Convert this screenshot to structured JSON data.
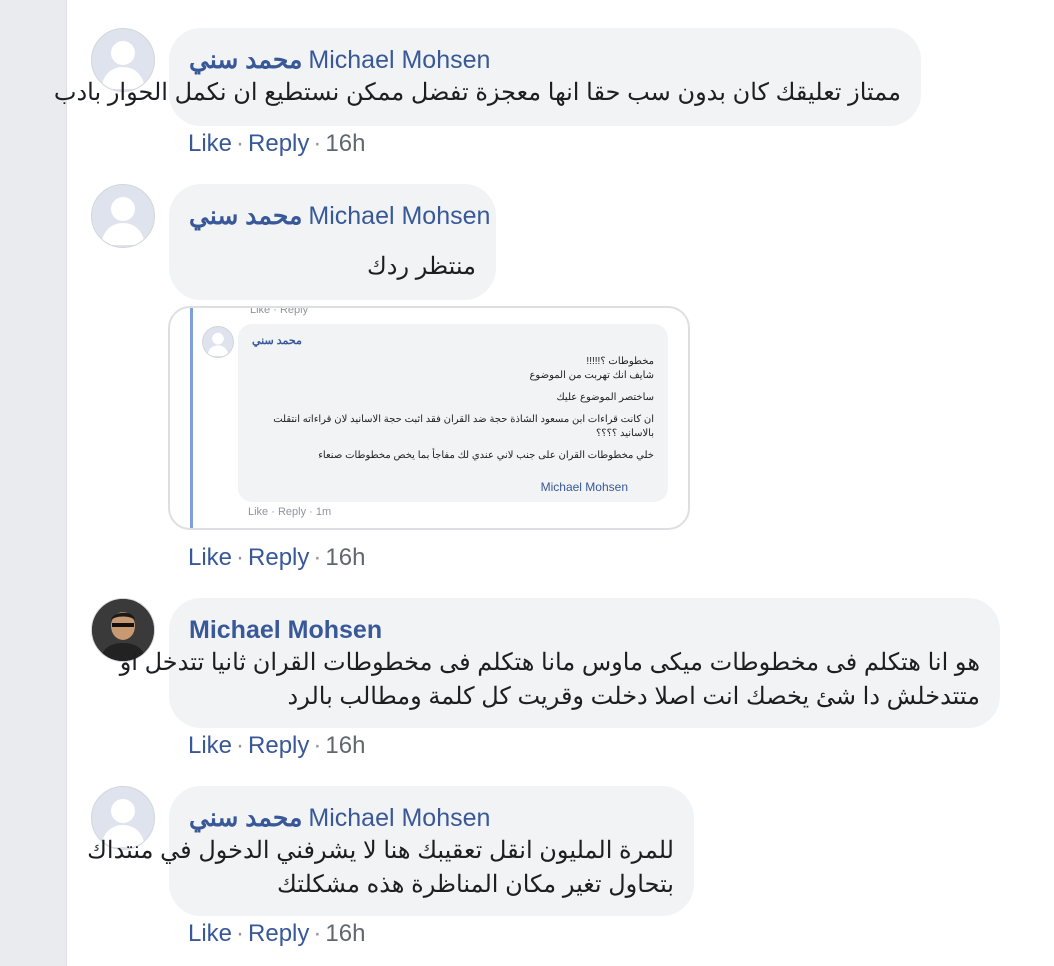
{
  "actions": {
    "like": "Like",
    "reply": "Reply",
    "sep": "·"
  },
  "comments": [
    {
      "name_ar": "محمد سني",
      "name_en": "Michael Mohsen",
      "lines": [
        "ممتاز تعليقك كان بدون سب حقا انها معجزة تفضل ممكن نستطيع ان نكمل الحوار بادب"
      ],
      "time": "16h"
    },
    {
      "name_ar": "محمد سني",
      "name_en": "Michael Mohsen",
      "lines": [
        "منتظر ردك"
      ],
      "time": "16h"
    },
    {
      "name": "Michael Mohsen",
      "lines": [
        "هو انا هتكلم فى مخطوطات ميكى ماوس مانا هتكلم فى مخطوطات القران ثانيا تتدخل او",
        "متتدخلش دا شئ يخصك انت اصلا دخلت وقريت كل كلمة ومطالب بالرد"
      ],
      "time": "16h"
    },
    {
      "name_ar": "محمد سني",
      "name_en": "Michael Mohsen",
      "lines": [
        "للمرة المليون انقل تعقيبك هنا لا يشرفني الدخول في منتداك",
        "بتحاول تغير مكان المناظرة هذه مشكلتك"
      ],
      "time": "16h"
    }
  ],
  "attachment": {
    "top_actions": "Like · Reply",
    "name": "محمد سني",
    "lines": [
      "مخطوطات ؟!!!!!",
      "شايف انك تهربت من الموضوع",
      "",
      "ساختصر الموضوع عليك",
      "",
      "ان كانت قراءات ابن مسعود الشاذة حجة ضد القران فقد اثبت حجة الاسانيد لان قراءاته انتقلت",
      "بالاسانيد ؟؟؟؟",
      "",
      "خلي مخطوطات القران على جنب لاني عندي لك مفاجأ بما يخص مخطوطات صنعاء"
    ],
    "signature": "Michael Mohsen",
    "bottom_actions": "Like · Reply · 1m"
  }
}
